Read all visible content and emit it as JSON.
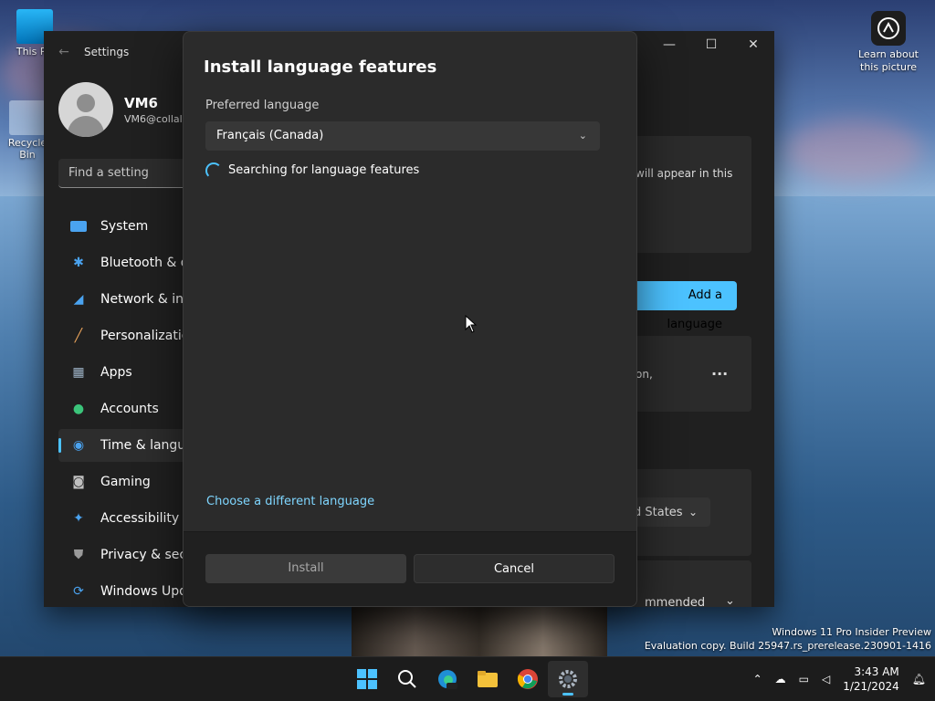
{
  "desktop": {
    "icons": [
      {
        "label": "This PC"
      },
      {
        "label": "Recycle Bin"
      }
    ],
    "learn": {
      "line1": "Learn about",
      "line2": "this picture"
    },
    "watermark": {
      "line1": "Windows 11 Pro Insider Preview",
      "line2": "Evaluation copy. Build 25947.rs_prerelease.230901-1416"
    }
  },
  "settings": {
    "title": "Settings",
    "user": {
      "name": "VM6",
      "email": "VM6@collal"
    },
    "search_placeholder": "Find a setting",
    "nav": [
      {
        "label": "System"
      },
      {
        "label": "Bluetooth & de"
      },
      {
        "label": "Network & inte"
      },
      {
        "label": "Personalization"
      },
      {
        "label": "Apps"
      },
      {
        "label": "Accounts"
      },
      {
        "label": "Time & langua"
      },
      {
        "label": "Gaming"
      },
      {
        "label": "Accessibility"
      },
      {
        "label": "Privacy & secur"
      },
      {
        "label": "Windows Upda"
      }
    ],
    "selected_index": 6,
    "bg": {
      "appear_text": "will appear in this",
      "add_language": "Add a language",
      "option_text": "on,",
      "more": "···",
      "region": "d States",
      "recommended": "mmended"
    }
  },
  "dialog": {
    "title": "Install language features",
    "preferred_label": "Preferred language",
    "selected_language": "Français (Canada)",
    "status": "Searching for language features",
    "choose_link": "Choose a different language",
    "install_button": "Install",
    "cancel_button": "Cancel"
  },
  "taskbar": {
    "time": "3:43 AM",
    "date": "1/21/2024"
  },
  "colors": {
    "accent": "#4cc2ff"
  }
}
